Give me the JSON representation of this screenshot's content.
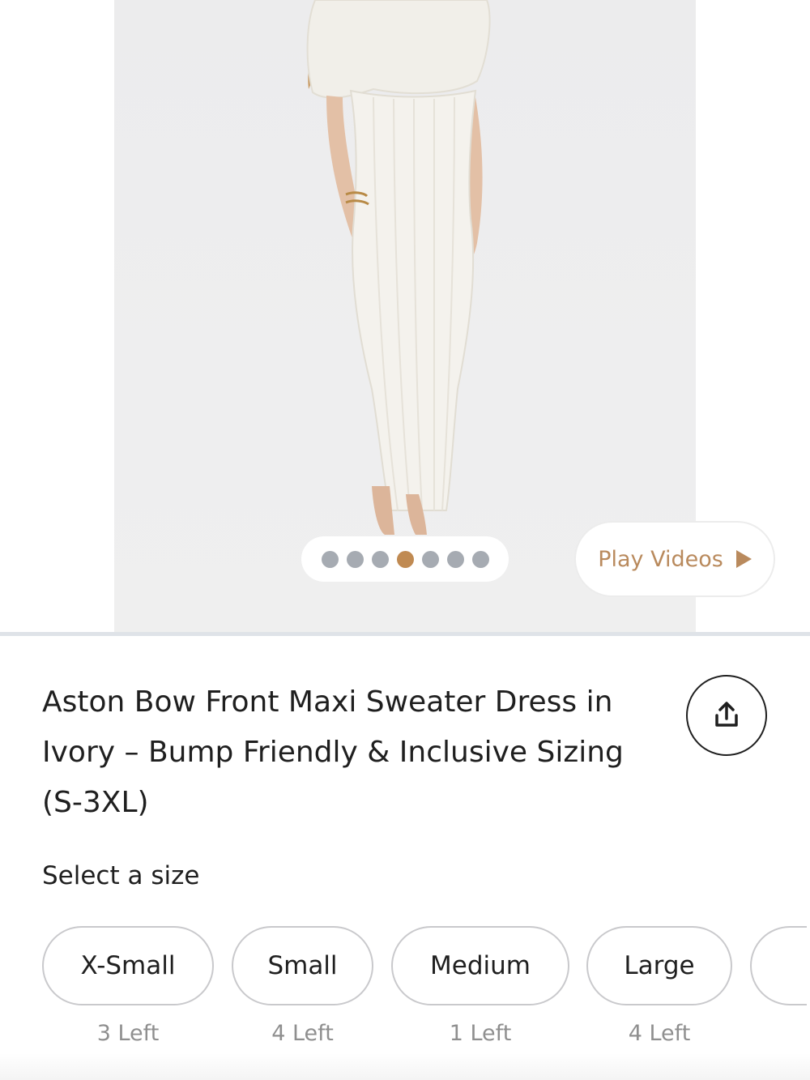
{
  "gallery": {
    "image_alt": "Aston Bow Front Maxi Sweater Dress in Ivory",
    "dots_count": 7,
    "active_dot_index": 3,
    "play_videos_label": "Play Videos"
  },
  "product": {
    "title": "Aston Bow Front Maxi Sweater Dress in Ivory – Bump Friendly & Inclusive Sizing (S-3XL)"
  },
  "size_selector": {
    "label": "Select a size",
    "options": [
      {
        "name": "X-Small",
        "stock": "3 Left"
      },
      {
        "name": "Small",
        "stock": "4 Left"
      },
      {
        "name": "Medium",
        "stock": "1 Left"
      },
      {
        "name": "Large",
        "stock": "4 Left"
      },
      {
        "name": "",
        "stock": ""
      }
    ]
  },
  "colors": {
    "accent": "#c08a52",
    "dot_inactive": "#a6abb2",
    "text": "#1f1f1f",
    "muted": "#8f8f8f"
  },
  "icons": {
    "share": "share-icon",
    "play": "play-icon"
  }
}
